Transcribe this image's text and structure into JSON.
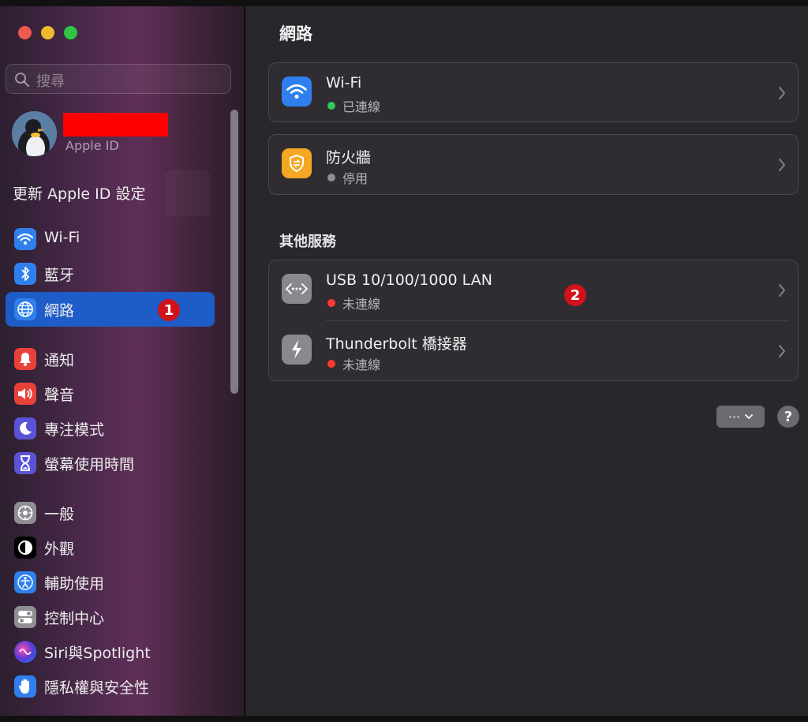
{
  "sidebar": {
    "search_placeholder": "搜尋",
    "profile": {
      "subtitle": "Apple ID"
    },
    "update_label": "更新 Apple ID 設定",
    "items": [
      {
        "label": "Wi-Fi",
        "icon": "wifi-icon",
        "color": "#2f80ed"
      },
      {
        "label": "藍牙",
        "icon": "bluetooth-icon",
        "color": "#2f80ed"
      },
      {
        "label": "網路",
        "icon": "globe-icon",
        "color": "#2f80ed",
        "selected": true,
        "badge": "1"
      },
      {
        "label": "通知",
        "icon": "bell-icon",
        "color": "#e8413a"
      },
      {
        "label": "聲音",
        "icon": "speaker-icon",
        "color": "#e8413a"
      },
      {
        "label": "專注模式",
        "icon": "moon-icon",
        "color": "#5b53d6"
      },
      {
        "label": "螢幕使用時間",
        "icon": "hourglass-icon",
        "color": "#5b53d6"
      },
      {
        "label": "一般",
        "icon": "gear-icon",
        "color": "#8e8e93"
      },
      {
        "label": "外觀",
        "icon": "appearance-icon",
        "color": "#000000"
      },
      {
        "label": "輔助使用",
        "icon": "accessibility-icon",
        "color": "#2f80ed"
      },
      {
        "label": "控制中心",
        "icon": "toggles-icon",
        "color": "#8e8e93"
      },
      {
        "label": "Siri與Spotlight",
        "icon": "siri-icon",
        "color": "#5a3bd6"
      },
      {
        "label": "隱私權與安全性",
        "icon": "hand-icon",
        "color": "#2f80ed"
      }
    ]
  },
  "main": {
    "title": "網路",
    "services": [
      {
        "name": "Wi-Fi",
        "status": "已連線",
        "status_color": "#33c759",
        "icon": "wifi-icon",
        "icon_color": "#2f80ed"
      },
      {
        "name": "防火牆",
        "status": "停用",
        "status_color": "#8e8e93",
        "icon": "firewall-icon",
        "icon_color": "#f5a623"
      }
    ],
    "other_title": "其他服務",
    "other_services": [
      {
        "name": "USB 10/100/1000 LAN",
        "status": "未連線",
        "status_color": "#ff3b30",
        "icon": "ethernet-icon",
        "badge": "2"
      },
      {
        "name": "Thunderbolt 橋接器",
        "status": "未連線",
        "status_color": "#ff3b30",
        "icon": "thunderbolt-icon"
      }
    ],
    "more_label": "···",
    "help_label": "?"
  }
}
